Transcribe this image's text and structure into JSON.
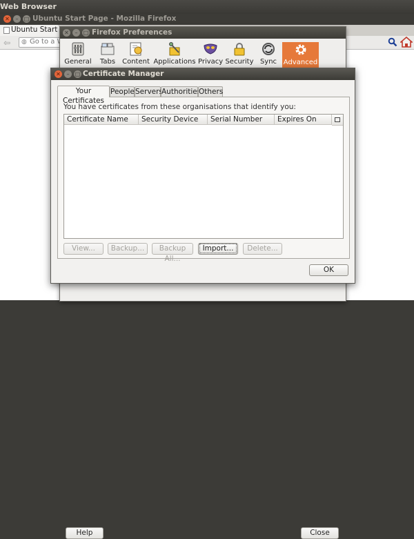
{
  "desktop": {
    "app_title": "Web Browser"
  },
  "firefox": {
    "window_title": "Ubuntu Start Page - Mozilla Firefox",
    "tab_label": "Ubuntu Start Pag",
    "url_text": "Go to a W"
  },
  "prefs": {
    "title": "Firefox Preferences",
    "panes": [
      {
        "label": "General",
        "icon": "general-icon"
      },
      {
        "label": "Tabs",
        "icon": "tabs-icon"
      },
      {
        "label": "Content",
        "icon": "content-icon"
      },
      {
        "label": "Applications",
        "icon": "applications-icon"
      },
      {
        "label": "Privacy",
        "icon": "privacy-icon"
      },
      {
        "label": "Security",
        "icon": "lock-icon"
      },
      {
        "label": "Sync",
        "icon": "sync-icon"
      },
      {
        "label": "Advanced",
        "icon": "gear-icon"
      }
    ],
    "selected_pane": "Advanced",
    "help_label": "Help",
    "close_label": "Close"
  },
  "cert_manager": {
    "title": "Certificate Manager",
    "tabs": [
      "Your Certificates",
      "People",
      "Servers",
      "Authorities",
      "Others"
    ],
    "selected_tab": "Your Certificates",
    "message": "You have certificates from these organisations that identify you:",
    "columns": [
      "Certificate Name",
      "Security Device",
      "Serial Number",
      "Expires On"
    ],
    "rows": [],
    "buttons": {
      "view": "View...",
      "backup": "Backup...",
      "backup_all": "Backup All...",
      "import": "Import...",
      "delete": "Delete..."
    },
    "ok_label": "OK"
  },
  "colors": {
    "accent": "#e6793a",
    "close_button": "#e3653a",
    "title_bar": "#3c3b37"
  }
}
